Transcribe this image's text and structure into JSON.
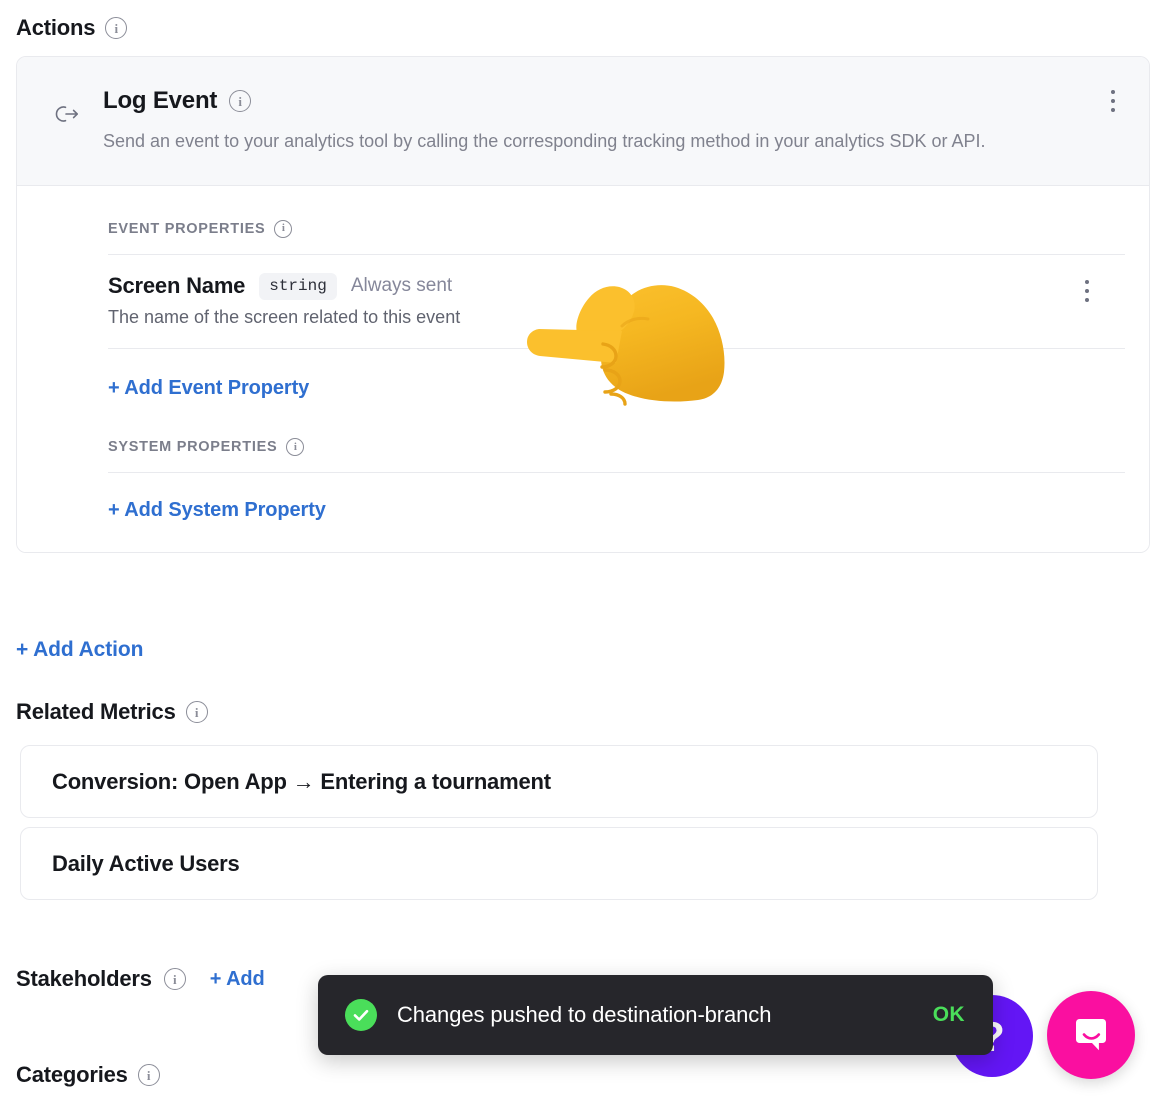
{
  "actions_section": {
    "title": "Actions",
    "info_icon": "info-icon"
  },
  "action_card": {
    "type_icon": "log-event-arrow-icon",
    "title": "Log Event",
    "description": "Send an event to your analytics tool by calling the corresponding tracking method in your analytics SDK or API.",
    "menu_icon": "kebab-menu-icon",
    "event_properties": {
      "label": "EVENT PROPERTIES",
      "rows": [
        {
          "name": "Screen Name",
          "type": "string",
          "sent": "Always sent",
          "description": "The name of the screen related to this event"
        }
      ],
      "add_label": "+ Add Event Property"
    },
    "system_properties": {
      "label": "SYSTEM PROPERTIES",
      "rows": [],
      "add_label": "+ Add System Property"
    }
  },
  "add_action_label": "+ Add Action",
  "related_metrics": {
    "title": "Related Metrics",
    "items": [
      {
        "label": "Conversion: Open App → Entering a tournament"
      },
      {
        "label": "Daily Active Users"
      }
    ]
  },
  "stakeholders": {
    "title": "Stakeholders",
    "add_label": "+ Add"
  },
  "categories": {
    "title": "Categories"
  },
  "toast": {
    "status_icon": "check-circle-icon",
    "message": "Changes pushed to destination-branch",
    "action_label": "OK",
    "background": "#26262b",
    "accent": "#4ade5a"
  },
  "floating_buttons": {
    "help": {
      "icon": "question-mark-icon",
      "label": "?",
      "color": "#6316f5"
    },
    "chat": {
      "icon": "intercom-chat-icon",
      "color": "#fa0fa0"
    }
  },
  "cursor_overlay": {
    "icon": "backhand-index-pointing-left-emoji"
  }
}
